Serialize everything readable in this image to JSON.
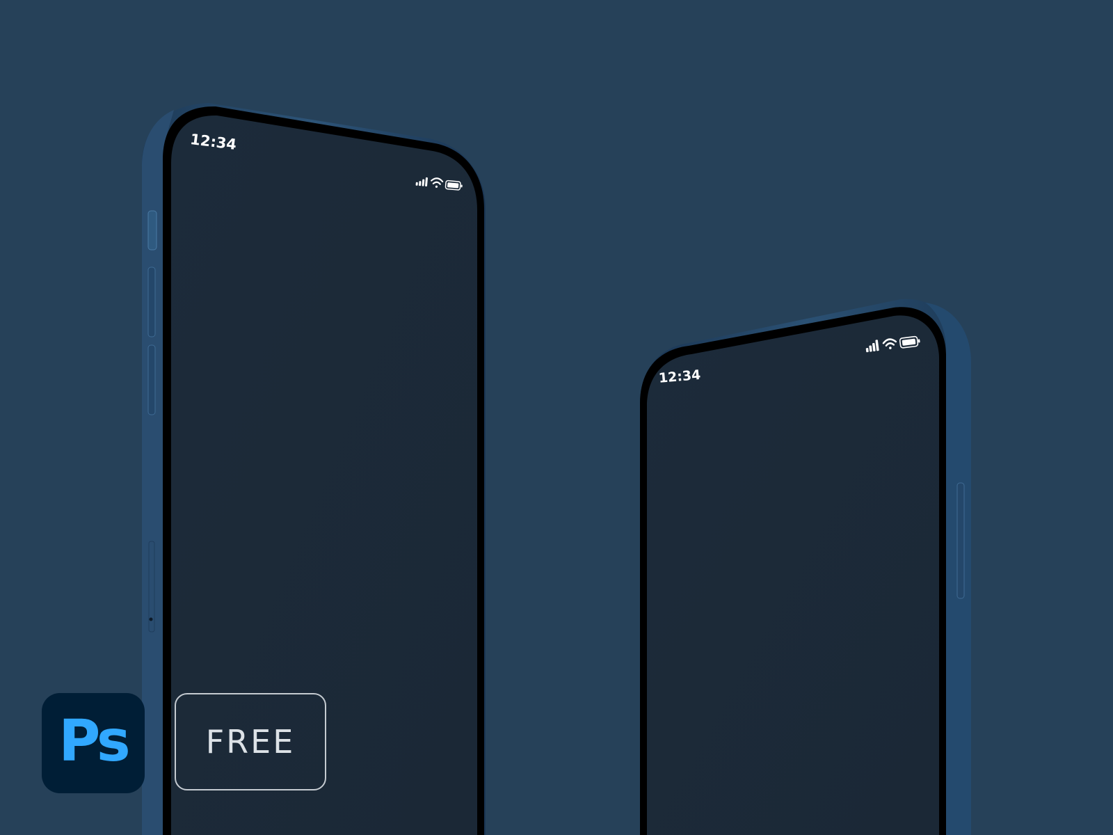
{
  "background_color": "#264159",
  "phone_left": {
    "status_time": "12:34",
    "icons": [
      "cellular-signal-icon",
      "wifi-icon",
      "battery-icon"
    ]
  },
  "phone_right": {
    "status_time": "12:34",
    "icons": [
      "cellular-signal-icon",
      "wifi-icon",
      "battery-icon"
    ]
  },
  "app_logo": {
    "name": "photoshop-logo",
    "text": "Ps",
    "bg_color": "#001e36",
    "text_color": "#31a8ff"
  },
  "badge": {
    "label": "FREE"
  }
}
